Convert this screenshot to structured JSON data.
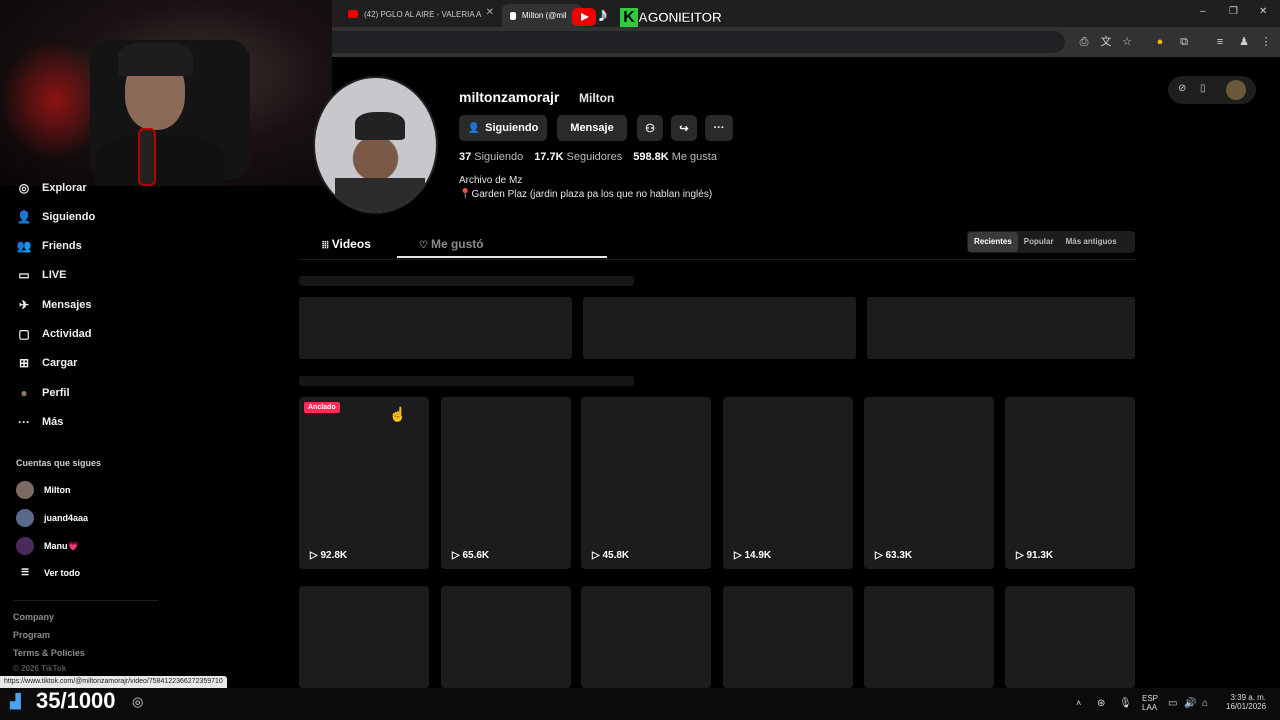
{
  "browser": {
    "tabs": [
      {
        "label": "(42) PGLO AL AIRE - VALERIA A"
      },
      {
        "label": "Milton (@mil"
      }
    ],
    "window_controls": [
      "–",
      "❐",
      "✕"
    ]
  },
  "overlay": {
    "brand": "AGONIEITOR",
    "k_letter": "K",
    "counter": "35/1000"
  },
  "sidebar": {
    "nav": [
      {
        "label": "Explorar",
        "icon": "compass-icon",
        "glyph": "◎"
      },
      {
        "label": "Siguiendo",
        "icon": "following-icon",
        "glyph": "👤"
      },
      {
        "label": "Friends",
        "icon": "friends-icon",
        "glyph": "👥"
      },
      {
        "label": "LIVE",
        "icon": "live-icon",
        "glyph": "▭"
      },
      {
        "label": "Mensajes",
        "icon": "messages-icon",
        "glyph": "✈"
      },
      {
        "label": "Actividad",
        "icon": "activity-icon",
        "glyph": "▢"
      },
      {
        "label": "Cargar",
        "icon": "upload-icon",
        "glyph": "⊞"
      },
      {
        "label": "Perfil",
        "icon": "profile-icon",
        "glyph": "●"
      },
      {
        "label": "Más",
        "icon": "more-icon",
        "glyph": "···"
      }
    ],
    "following_title": "Cuentas que sigues",
    "following": [
      {
        "name": "Milton",
        "color": "#7d6b60"
      },
      {
        "name": "juand4aaa",
        "color": "#5a6a8a"
      },
      {
        "name": "Manu💗",
        "color": "#4a2a5a"
      }
    ],
    "see_all": "Ver todo",
    "footer": [
      "Company",
      "Program",
      "Terms & Policies",
      "© 2026 TikTok"
    ]
  },
  "profile": {
    "username": "miltonzamorajr",
    "nickname": "Milton",
    "buttons": {
      "following": "Siguiendo",
      "message": "Mensaje"
    },
    "stats": [
      {
        "value": "37",
        "label": "Siguiendo"
      },
      {
        "value": "17.7K",
        "label": "Seguidores"
      },
      {
        "value": "598.8K",
        "label": "Me gusta"
      }
    ],
    "bio": [
      "Archivo de Mz",
      "📍Garden Plaz (jardin plaza pa los que no hablan inglés)"
    ]
  },
  "tabs": {
    "videos": "Videos",
    "liked": "Me gustó"
  },
  "sort": [
    "Recientes",
    "Popular",
    "Más antiguos"
  ],
  "pinned_badge": "Anclado",
  "videos": [
    {
      "views": "92.8K"
    },
    {
      "views": "65.6K"
    },
    {
      "views": "45.8K"
    },
    {
      "views": "14.9K"
    },
    {
      "views": "63.3K"
    },
    {
      "views": "91.3K"
    }
  ],
  "status_url": "https://www.tiktok.com/@miltonzamorajr/video/7584122366272359710",
  "tray": {
    "lang1": "ESP",
    "lang2": "LAA",
    "time": "3:39 a. m.",
    "date": "16/01/2026"
  },
  "colors": {
    "accent": "#fe2c55",
    "card": "#1c1c1c"
  }
}
